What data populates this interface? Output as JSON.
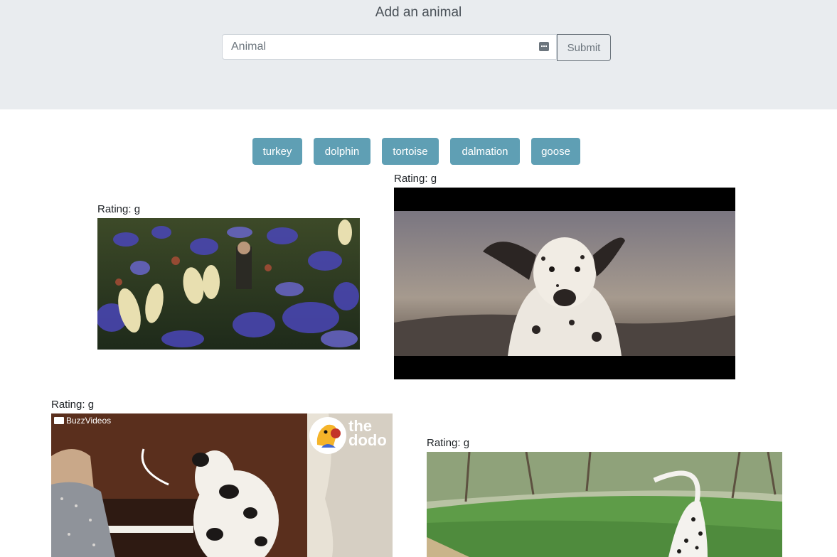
{
  "header": {
    "title": "Add an animal",
    "input_placeholder": "Animal",
    "input_value": "",
    "submit_label": "Submit",
    "input_icon": "keyboard-icon"
  },
  "animals": [
    "turkey",
    "dolphin",
    "tortoise",
    "dalmation",
    "goose"
  ],
  "results": [
    {
      "rating": "Rating: g"
    },
    {
      "rating": "Rating: g"
    },
    {
      "rating": "Rating: g",
      "watermark": "BuzzVideos",
      "logo": {
        "line1": "the",
        "line2": "dodo"
      }
    },
    {
      "rating": "Rating: g"
    }
  ]
}
